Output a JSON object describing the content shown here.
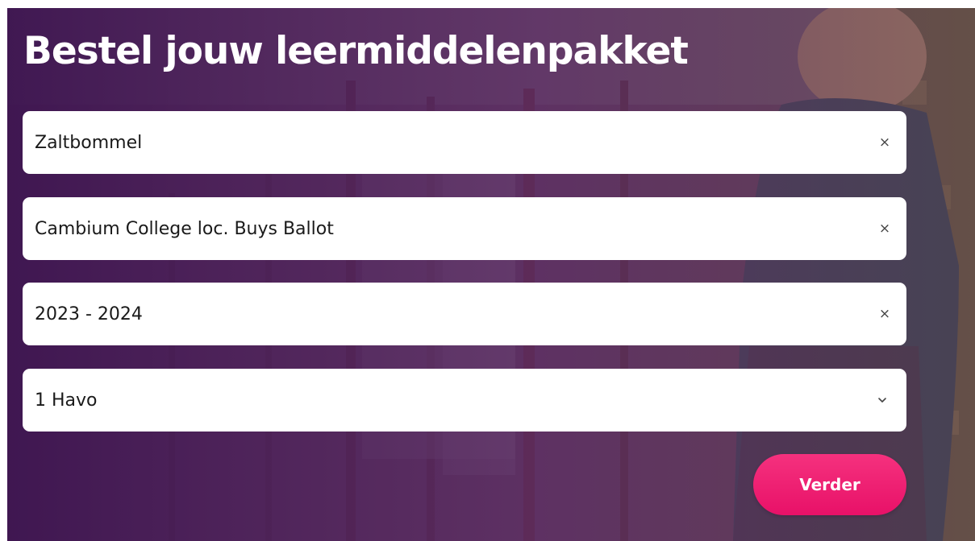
{
  "header": {
    "title": "Bestel jouw leermiddelenpakket"
  },
  "form": {
    "fields": [
      {
        "value": "Zaltbommel",
        "action_icon": "clear-icon",
        "action_glyph": "×"
      },
      {
        "value": "Cambium College loc. Buys Ballot",
        "action_icon": "clear-icon",
        "action_glyph": "×"
      },
      {
        "value": "2023 - 2024",
        "action_icon": "clear-icon",
        "action_glyph": "×"
      },
      {
        "value": "1 Havo",
        "action_icon": "chevron-down-icon"
      }
    ],
    "submit_label": "Verder"
  },
  "colors": {
    "overlay": "#4a1f5c",
    "button": "#ec1a6e",
    "field_background": "#ffffff",
    "title_text": "#ffffff"
  }
}
